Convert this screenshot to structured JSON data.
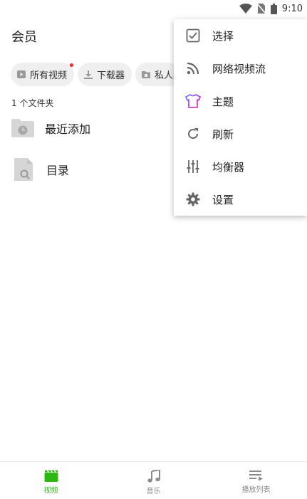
{
  "status_bar": {
    "time": "9:10"
  },
  "header": {
    "title": "会员"
  },
  "chips": [
    {
      "label": "所有视频",
      "has_badge": true,
      "icon": "play-box-icon"
    },
    {
      "label": "下载器",
      "icon": "download-icon"
    },
    {
      "label": "私人",
      "icon": "private-folder-icon"
    }
  ],
  "folders": {
    "count_text": "1 个文件夹",
    "items": [
      {
        "label": "最近添加",
        "icon": "recent-folder-icon"
      },
      {
        "label": "目录",
        "icon": "search-file-icon"
      }
    ]
  },
  "menu": {
    "items": [
      {
        "label": "选择",
        "icon": "checkbox-icon"
      },
      {
        "label": "网络视频流",
        "icon": "rss-icon"
      },
      {
        "label": "主题",
        "icon": "tshirt-icon"
      },
      {
        "label": "刷新",
        "icon": "refresh-icon"
      },
      {
        "label": "均衡器",
        "icon": "equalizer-icon"
      },
      {
        "label": "设置",
        "icon": "gear-icon"
      }
    ]
  },
  "bottom_nav": {
    "items": [
      {
        "label": "视频",
        "icon": "clapperboard-icon",
        "active": true
      },
      {
        "label": "音乐",
        "icon": "music-note-icon"
      },
      {
        "label": "播放列表",
        "icon": "playlist-icon"
      }
    ]
  },
  "colors": {
    "accent": "#2bb812",
    "badge": "#ff2222"
  }
}
